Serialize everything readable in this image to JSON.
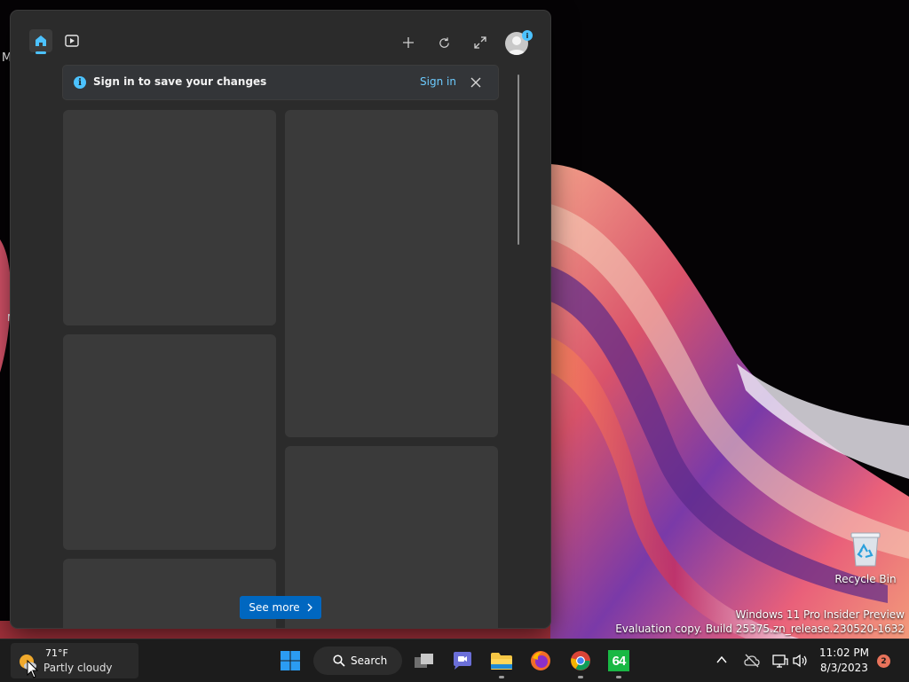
{
  "desktop": {
    "left_label_1": "M",
    "left_label_2": "N",
    "recycle_bin_label": "Recycle Bin",
    "watermark_line1": "Windows 11 Pro Insider Preview",
    "watermark_line2": "Evaluation copy. Build 25375.zn_release.230520-1632"
  },
  "widgets_panel": {
    "header": {
      "tabs": [
        {
          "name": "home-icon",
          "selected": true
        },
        {
          "name": "video-icon",
          "selected": false
        }
      ],
      "actions": [
        "add-icon",
        "refresh-icon",
        "expand-icon"
      ],
      "profile_badge": "i"
    },
    "signin_banner": {
      "info_icon_glyph": "i",
      "message": "Sign in to save your changes",
      "link": "Sign in"
    },
    "cards_state": "loading-placeholders",
    "see_more_label": "See more"
  },
  "taskbar": {
    "weather": {
      "temperature": "71°F",
      "condition": "Partly cloudy"
    },
    "search_label": "Search",
    "pinned_apps": [
      "start",
      "search",
      "task-view",
      "teams",
      "file-explorer",
      "firefox",
      "chrome",
      "app-64"
    ],
    "app64_label": "64",
    "clock": {
      "time": "11:02 PM",
      "date": "8/3/2023"
    },
    "notification_count": "2"
  },
  "colors": {
    "accent": "#4cc2ff",
    "button_blue": "#0067c0",
    "panel_bg": "#2b2b2b",
    "card_bg": "#3a3a3a",
    "taskbar_bg": "#1c1c1c",
    "notification_badge": "#e8735b"
  }
}
